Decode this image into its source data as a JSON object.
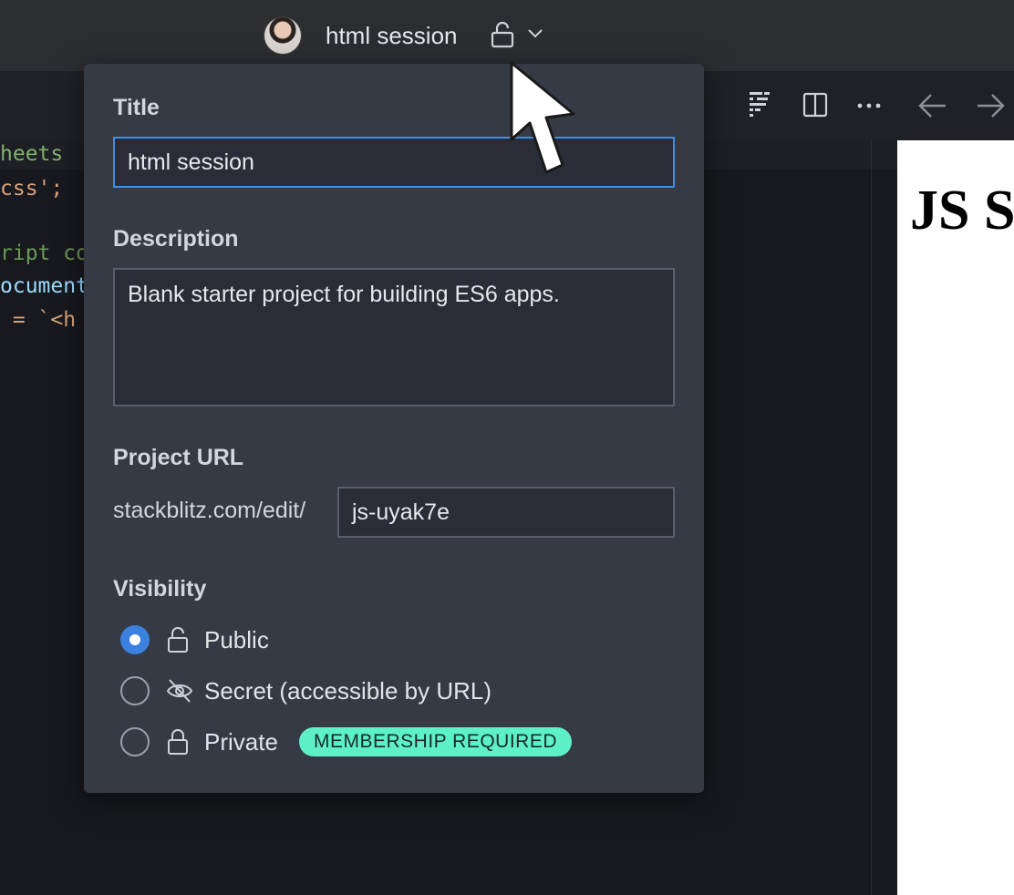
{
  "header": {
    "session_title": "html session",
    "avatar_icon": "user-avatar",
    "visibility_icon": "unlock-icon",
    "dropdown_icon": "chevron-down-icon"
  },
  "toolbar": {
    "icons": [
      "prettier-icon",
      "split-view-icon",
      "more-icon",
      "back-arrow-icon",
      "forward-arrow-icon"
    ]
  },
  "editor": {
    "lines": [
      "heets",
      "css';",
      "ript co",
      "ocument",
      " = `<h"
    ]
  },
  "preview": {
    "heading": "JS S"
  },
  "project_panel": {
    "title_label": "Title",
    "title_value": "html session",
    "description_label": "Description",
    "description_value": "Blank starter project for building ES6 apps.",
    "url_label": "Project URL",
    "url_prefix": "stackblitz.com/edit/",
    "url_slug": "js-uyak7e",
    "visibility_label": "Visibility",
    "options": [
      {
        "label": "Public",
        "icon": "unlock-icon",
        "selected": true
      },
      {
        "label": "Secret (accessible by URL)",
        "icon": "eye-off-icon",
        "selected": false
      },
      {
        "label": "Private",
        "icon": "lock-icon",
        "selected": false,
        "badge": "MEMBERSHIP REQUIRED"
      }
    ]
  },
  "colors": {
    "accent": "#3b82e0",
    "badge": "#5ef0c6",
    "panel": "#363a45"
  }
}
